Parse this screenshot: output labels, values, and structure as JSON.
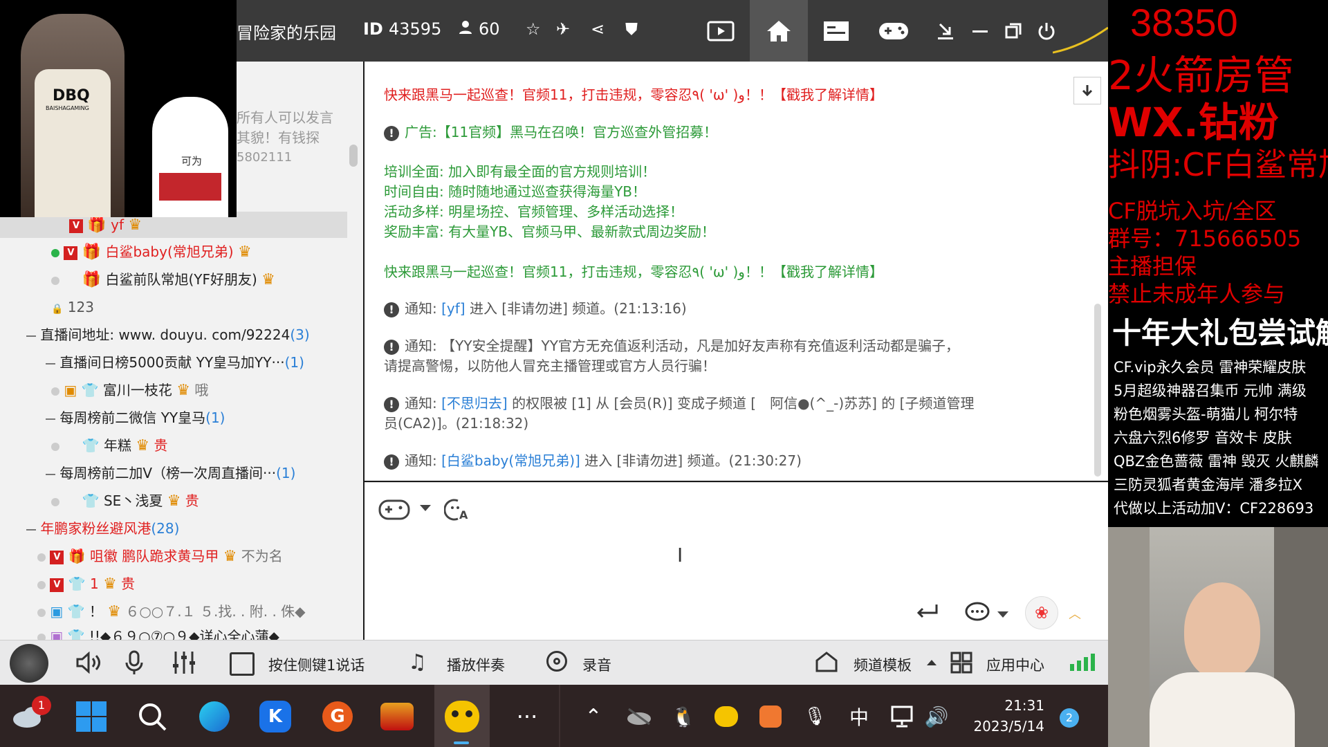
{
  "titlebar": {
    "channel_name": "冒险家的乐园",
    "id_label": "ID",
    "id_value": "43595",
    "user_count": "60"
  },
  "left": {
    "partial_announce": "所有人可以发言",
    "partial_line2": "其貌！有钱探",
    "partial_line3": "5802111",
    "users_top": [
      {
        "name": "yf"
      },
      {
        "name": "白鲨baby(常旭兄弟)"
      },
      {
        "name": "白鲨前队常旭(YF好朋友)"
      },
      {
        "name": "123"
      }
    ],
    "group1": {
      "name": "直播间地址: www. douyu. com/92224",
      "count": "(3)"
    },
    "sub1": {
      "name": "直播间日榜5000贡献 YY皇马加YY···",
      "count": "(1)",
      "user": "富川一枝花",
      "extra": "哦"
    },
    "sub2": {
      "name": "每周榜前二微信 YY皇马",
      "count": "(1)",
      "user": "年糕",
      "extra": "贵"
    },
    "sub3": {
      "name": "每周榜前二加V（榜一次周直播间···",
      "count": "(1)",
      "user": "SE丶浅夏",
      "extra": "贵"
    },
    "group2": {
      "name": "年鹏家粉丝避风港",
      "count": "(28)"
    },
    "users_bottom": [
      {
        "name": "咀徽 鹏队跪求黄马甲",
        "extra": "不为名"
      },
      {
        "name": "1",
        "extra": "贵"
      },
      {
        "name": "！",
        "extra": "６○○７.１ ５.找. . 附. . 侏◆"
      },
      {
        "name": "!!◆６９○⑦○９◆详心全心蒲◆",
        "extra": ""
      }
    ]
  },
  "chat": {
    "msg1": "快来跟黑马一起巡查！官频11，打击违规，零容忍٩( 'ω' )و！！【戳我了解详情】",
    "msg2": "广告:【11官频】黑马在召唤！官方巡查外管招募！",
    "msg3": "培训全面: 加入即有最全面的官方规则培训！",
    "msg4": "时间自由: 随时随地通过巡查获得海量YB！",
    "msg5": "活动多样: 明星场控、官频管理、多样活动选择！",
    "msg6": "奖励丰富: 有大量YB、官频马甲、最新款式周边奖励！",
    "msg7": "快来跟黑马一起巡查！官频11，打击违规，零容忍٩( 'ω' )و！！【戳我了解详情】",
    "notice_label": "通知:",
    "n1_user": "[yf]",
    "n1_text": " 进入 [非请勿进] 频道。(21:13:16)",
    "n2_text_a": "【YY安全提醒】YY官方无充值返利活动，凡是加好友声称有充值返利活动都是骗子，",
    "n2_text_b": "请提高警惕，以防他人冒充主播管理或官方人员行骗！",
    "n3_user": "[不思归去]",
    "n3_text_a": " 的权限被 [1] 从 [会员(R)] 变成子频道 [　阿信●(^_-)苏苏] 的 [子频道管理",
    "n3_text_b": "员(CA2)]。(21:18:32)",
    "n4_user": "[白鲨baby(常旭兄弟)]",
    "n4_text": " 进入 [非请勿进] 频道。(21:30:27)"
  },
  "bottombar": {
    "ptt": "按住侧键1说话",
    "music": "播放伴奏",
    "record": "录音",
    "template": "频道模板",
    "apps": "应用中心"
  },
  "taskbar": {
    "weather_badge": "1",
    "ime": "中",
    "time": "21:31",
    "date": "2023/5/14",
    "notif": "2"
  },
  "overlay": {
    "l1": "38350",
    "l2": "2火箭房管",
    "l3": "WX.钻粉",
    "l4": "抖阴:CF白鲨常旭",
    "l5": "CF脱坑入坑/全区",
    "l6": "群号：715666505",
    "l7": "主播担保",
    "l8": "禁止未成年人参与",
    "l9": "十年大礼包尝试解封",
    "l10": "CF.vip永久会员 雷神荣耀皮肤",
    "l11": "5月超级神器召集币 元帅 满级",
    "l12": "粉色烟雾头盔-萌猫儿 柯尔特",
    "l13": "六盘六烈6修罗 音效卡 皮肤",
    "l14": "QBZ金色蔷薇 雷神 毁灭 火麒麟",
    "l15": "三防灵狐者黄金海岸 潘多拉X",
    "l16": "代做以上活动加V：CF228693"
  },
  "webcam": {
    "jersey1": "DBQ",
    "jersey1_sub": "BAISHAGAMING",
    "jersey2": "可为"
  },
  "colors": {
    "titlebar": "#3a3a3a",
    "chat_red": "#e02020",
    "chat_green": "#2c9a38",
    "overlay_red": "#e00000"
  }
}
